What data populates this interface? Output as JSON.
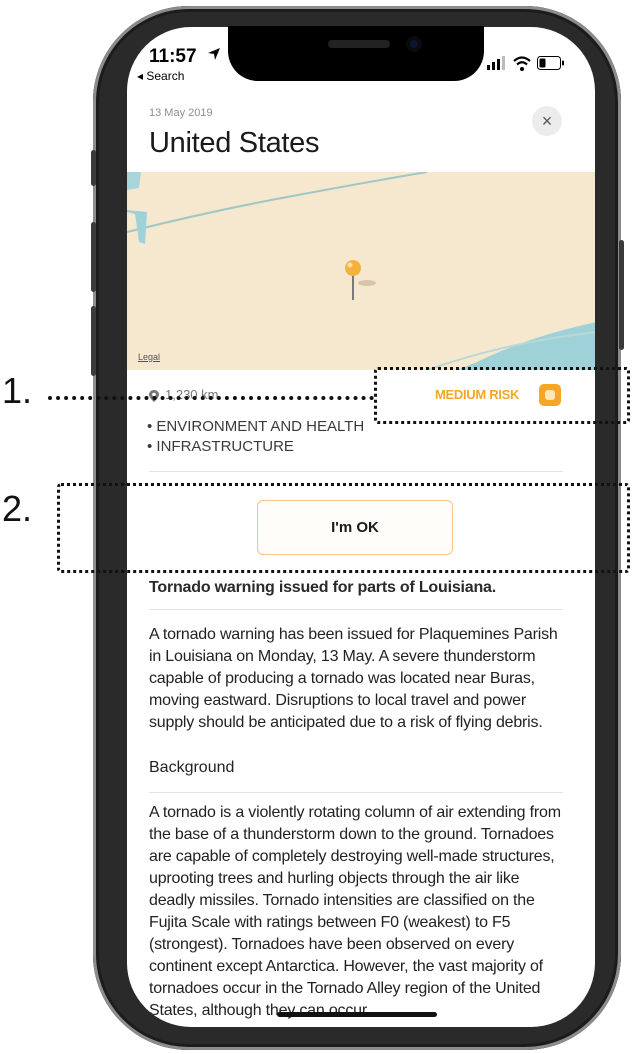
{
  "status_bar": {
    "time": "11:57",
    "back_label": "◂ Search"
  },
  "alert": {
    "date": "13 May 2019",
    "title": "United States",
    "close_glyph": "×",
    "map": {
      "legal_label": "Legal"
    },
    "distance": "1,230 km",
    "risk_label": "MEDIUM RISK",
    "risk_color": "#f5a624",
    "categories": [
      "• ENVIRONMENT AND HEALTH",
      "• INFRASTRUCTURE"
    ],
    "ok_button": "I'm OK",
    "headline": "Tornado warning issued for parts of Louisiana.",
    "paragraph1": "A tornado warning has been issued for Plaquemines Parish in Louisiana on Monday, 13 May. A severe thunderstorm capable of producing a tornado was located near Buras, moving eastward. Disruptions to local travel and power supply should be anticipated due to a risk of flying debris.",
    "section_title": "Background",
    "paragraph2": "A tornado is a violently rotating column of air extending from the base of a thunderstorm down to the ground. Tornadoes are capable of completely destroying well-made structures, uprooting trees and hurling objects through the air like deadly missiles. Tornado intensities are classified on the Fujita Scale with ratings between F0 (weakest) to F5 (strongest). Tornadoes have been observed on every continent except Antarctica. However, the vast majority of tornadoes occur in the Tornado Alley region of the United States, although they can occur"
  },
  "annotations": {
    "label1": "1.",
    "label2": "2."
  }
}
